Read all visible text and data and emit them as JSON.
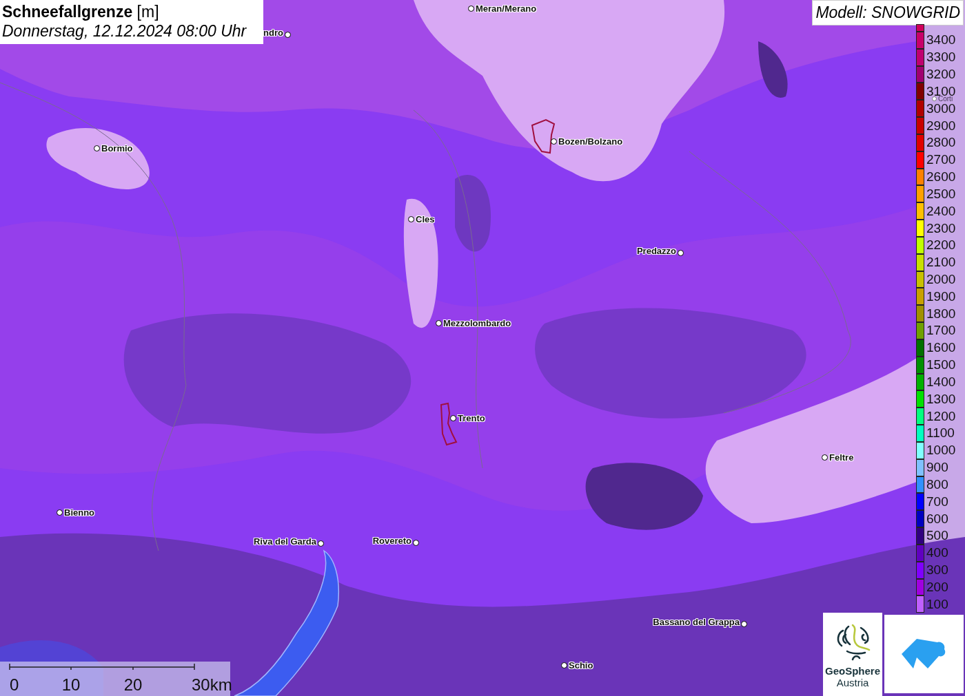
{
  "title": {
    "heading": "**Schneefallgrenze** [m]",
    "subtitle": "Donnerstag, 12.12.2024 08:00 Uhr"
  },
  "model_label": "Modell: SNOWGRID",
  "places": [
    {
      "name": "Meran/Merano"
    },
    {
      "name": "ndro"
    },
    {
      "name": "Bormio"
    },
    {
      "name": "Bozen/Bolzano"
    },
    {
      "name": "Cles"
    },
    {
      "name": "Predazzo"
    },
    {
      "name": "Mezzolombardo"
    },
    {
      "name": "Trento"
    },
    {
      "name": "Feltre"
    },
    {
      "name": "Bienno"
    },
    {
      "name": "Riva del Garda"
    },
    {
      "name": "Rovereto"
    },
    {
      "name": "Bassano del Grappa"
    },
    {
      "name": "Schio"
    },
    {
      "name": "Corti"
    }
  ],
  "legend": [
    {
      "color": "#d0005a"
    },
    {
      "label": "3400",
      "color": "#c8006a"
    },
    {
      "label": "3300",
      "color": "#c00070"
    },
    {
      "label": "3200",
      "color": "#a00070"
    },
    {
      "label": "3100",
      "color": "#800000"
    },
    {
      "label": "3000",
      "color": "#b00000"
    },
    {
      "label": "2900",
      "color": "#c80000"
    },
    {
      "label": "2800",
      "color": "#e00000"
    },
    {
      "label": "2700",
      "color": "#ff0000"
    },
    {
      "label": "2600",
      "color": "#ff8000"
    },
    {
      "label": "2500",
      "color": "#ffa000"
    },
    {
      "label": "2400",
      "color": "#ffc000"
    },
    {
      "label": "2300",
      "color": "#ffff00"
    },
    {
      "label": "2200",
      "color": "#c0ff00"
    },
    {
      "label": "2100",
      "color": "#c8e000"
    },
    {
      "label": "2000",
      "color": "#c8c000"
    },
    {
      "label": "1900",
      "color": "#c8a000"
    },
    {
      "label": "1800",
      "color": "#a09000"
    },
    {
      "label": "1700",
      "color": "#70a000"
    },
    {
      "label": "1600",
      "color": "#007000"
    },
    {
      "label": "1500",
      "color": "#009000"
    },
    {
      "label": "1400",
      "color": "#00b000"
    },
    {
      "label": "1300",
      "color": "#00e000"
    },
    {
      "label": "1200",
      "color": "#00ff80"
    },
    {
      "label": "1100",
      "color": "#00ffc0"
    },
    {
      "label": "1000",
      "color": "#80ffff"
    },
    {
      "label": "900",
      "color": "#80c0ff"
    },
    {
      "label": "800",
      "color": "#3090ff"
    },
    {
      "label": "700",
      "color": "#0000ff"
    },
    {
      "label": "600",
      "color": "#0000c0"
    },
    {
      "label": "500",
      "color": "#300080"
    },
    {
      "label": "400",
      "color": "#6000c0"
    },
    {
      "label": "300",
      "color": "#8000ff"
    },
    {
      "label": "200",
      "color": "#a000e0"
    },
    {
      "label": "100",
      "color": "#c060ff"
    }
  ],
  "scale_bar": {
    "ticks": [
      "0",
      "10",
      "20",
      "30km"
    ]
  },
  "logos": {
    "geosphere": {
      "name": "GeoSphere",
      "sub": "Austria"
    }
  }
}
